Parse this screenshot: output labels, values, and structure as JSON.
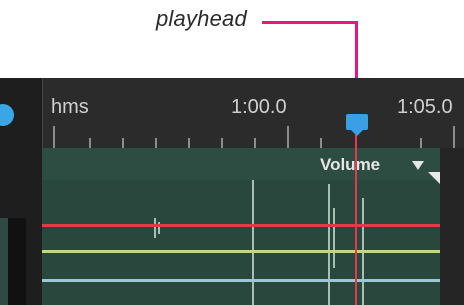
{
  "callout": {
    "label": "playhead",
    "color": "#e5197c"
  },
  "ruler": {
    "unit_label": "hms",
    "time_labels": [
      "1:00.0",
      "1:05.0"
    ]
  },
  "track": {
    "parameter_label": "Volume",
    "parameter_menu_icon": "triangle-down-icon",
    "colors": {
      "track_bg": "#29473d",
      "volume_envelope": "#e23a48",
      "pan_envelope": "#c6d28e",
      "lower_envelope": "#9ec7d6"
    }
  },
  "playhead": {
    "handle_color": "#3a9fe4",
    "line_color": "#e23a48"
  }
}
